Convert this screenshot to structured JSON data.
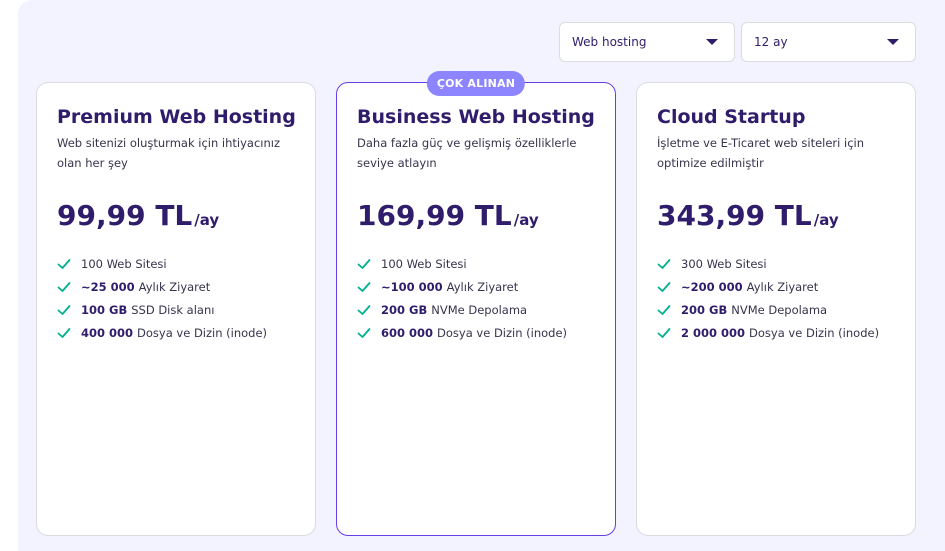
{
  "filters": {
    "hosting_type": "Web hosting",
    "period": "12 ay"
  },
  "plans": [
    {
      "title": "Premium Web Hosting",
      "description": "Web sitenizi oluşturmak için ihtiyacınız olan her şey",
      "price": "99,99 TL",
      "unit": "/ay",
      "badge": "",
      "features": [
        {
          "bold": "",
          "text": "100 Web Sitesi"
        },
        {
          "bold": "~25 000",
          "text": "Aylık Ziyaret"
        },
        {
          "bold": "100 GB",
          "text": "SSD Disk alanı"
        },
        {
          "bold": "400 000",
          "text": "Dosya ve Dizin (inode)"
        }
      ]
    },
    {
      "title": "Business Web Hosting",
      "description": "Daha fazla güç ve gelişmiş özelliklerle seviye atlayın",
      "price": "169,99 TL",
      "unit": "/ay",
      "badge": "ÇOK ALINAN",
      "features": [
        {
          "bold": "",
          "text": "100 Web Sitesi"
        },
        {
          "bold": "~100 000",
          "text": "Aylık Ziyaret"
        },
        {
          "bold": "200 GB",
          "text": "NVMe Depolama"
        },
        {
          "bold": "600 000",
          "text": "Dosya ve Dizin (inode)"
        }
      ]
    },
    {
      "title": "Cloud Startup",
      "description": "İşletme ve E-Ticaret web siteleri için optimize edilmiştir",
      "price": "343,99 TL",
      "unit": "/ay",
      "badge": "",
      "features": [
        {
          "bold": "",
          "text": "300 Web Sitesi"
        },
        {
          "bold": "~200 000",
          "text": "Aylık Ziyaret"
        },
        {
          "bold": "200 GB",
          "text": "NVMe Depolama"
        },
        {
          "bold": "2 000 000",
          "text": "Dosya ve Dizin (inode)"
        }
      ]
    }
  ],
  "colors": {
    "accent": "#673de6",
    "badge": "#8c85ff",
    "check": "#00b090",
    "heading": "#2f1c6a"
  },
  "icons": {
    "dropdown": "chevron-down-icon",
    "feature": "check-icon"
  }
}
